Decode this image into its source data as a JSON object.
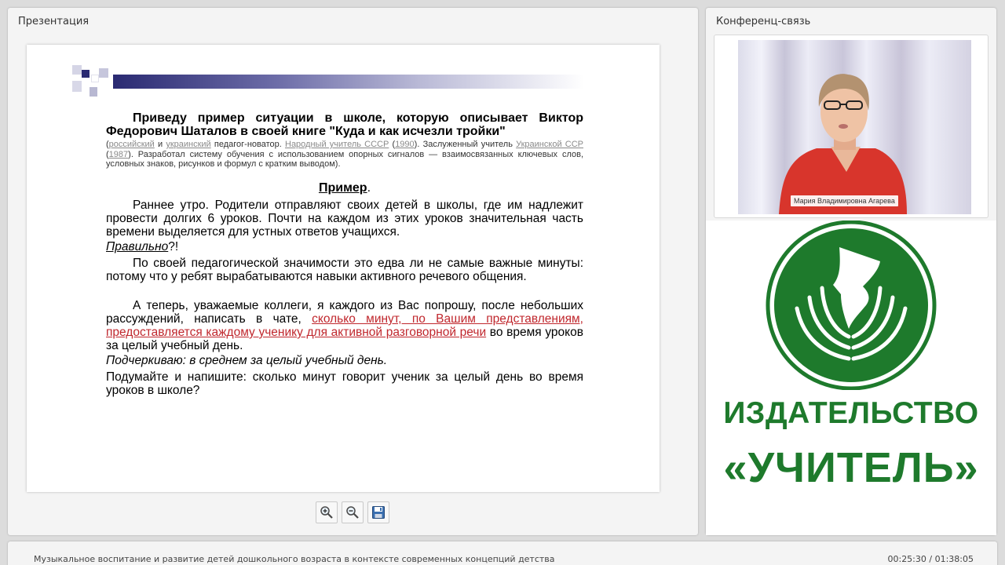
{
  "presentation": {
    "title": "Презентация",
    "slide": {
      "heading": "Приведу пример ситуации в школе, которую описывает Виктор Федорович Шаталов в своей книге  \"Куда и как исчезли тройки\"",
      "bio": {
        "open": "(",
        "link1": "российский",
        "and": " и ",
        "link2": "украинский",
        "t1": " педагог-новатор. ",
        "link3": "Народный учитель СССР",
        "t2": " (",
        "link4": "1990",
        "t3": "). Заслуженный учитель ",
        "link5": "Украинской ССР",
        "t4": " (",
        "link6": "1987",
        "t5": "). Разработал систему обучения с использованием опорных сигналов — взаимосвязанных ключевых слов, условных знаков, рисунков и формул с кратким выводом)."
      },
      "example_header": "Пример",
      "example_dot": ".",
      "p1": "Раннее утро. Родители отправляют своих детей в школы, где им надлежит провести долгих 6 уроков. Почти на каждом из этих уроков значительная часть времени выделяется для устных ответов учащихся.",
      "p2_italic": "Правильно",
      "p2_rest": "?!",
      "p3": "По своей педагогической значимости это едва ли не самые важные минуты: потому что у ребят вырабатываются навыки активного речевого общения.",
      "p4_start": "А теперь, уважаемые коллеги, я каждого из Вас попрошу, после небольших рассуждений, написать в чате, ",
      "p4_red": "сколько минут, по Вашим представлениям, предоставляется каждому ученику для активной разговорной речи",
      "p4_end": " во время уроков за целый учебный день.",
      "p5": "Подчеркиваю: в среднем за целый учебный день.",
      "p6": "Подумайте и напишите: сколько минут говорит ученик за целый день во время уроков в школе?"
    },
    "toolbar": {
      "zoom_in_icon": "zoom-in-icon",
      "zoom_out_icon": "zoom-out-icon",
      "save_icon": "save-icon"
    }
  },
  "conference": {
    "title": "Конференц-связь",
    "speaker_name": "Мария Владимировна Агарева",
    "logo_line1": "ИЗДАТЕЛЬСТВО",
    "logo_line2": "«УЧИТЕЛЬ»",
    "logo_color": "#1e7a2c"
  },
  "footer": {
    "course_title": "Музыкальное воспитание и развитие детей дошкольного возраста в контексте современных концепций детства",
    "time": "00:25:30 / 01:38:05"
  }
}
